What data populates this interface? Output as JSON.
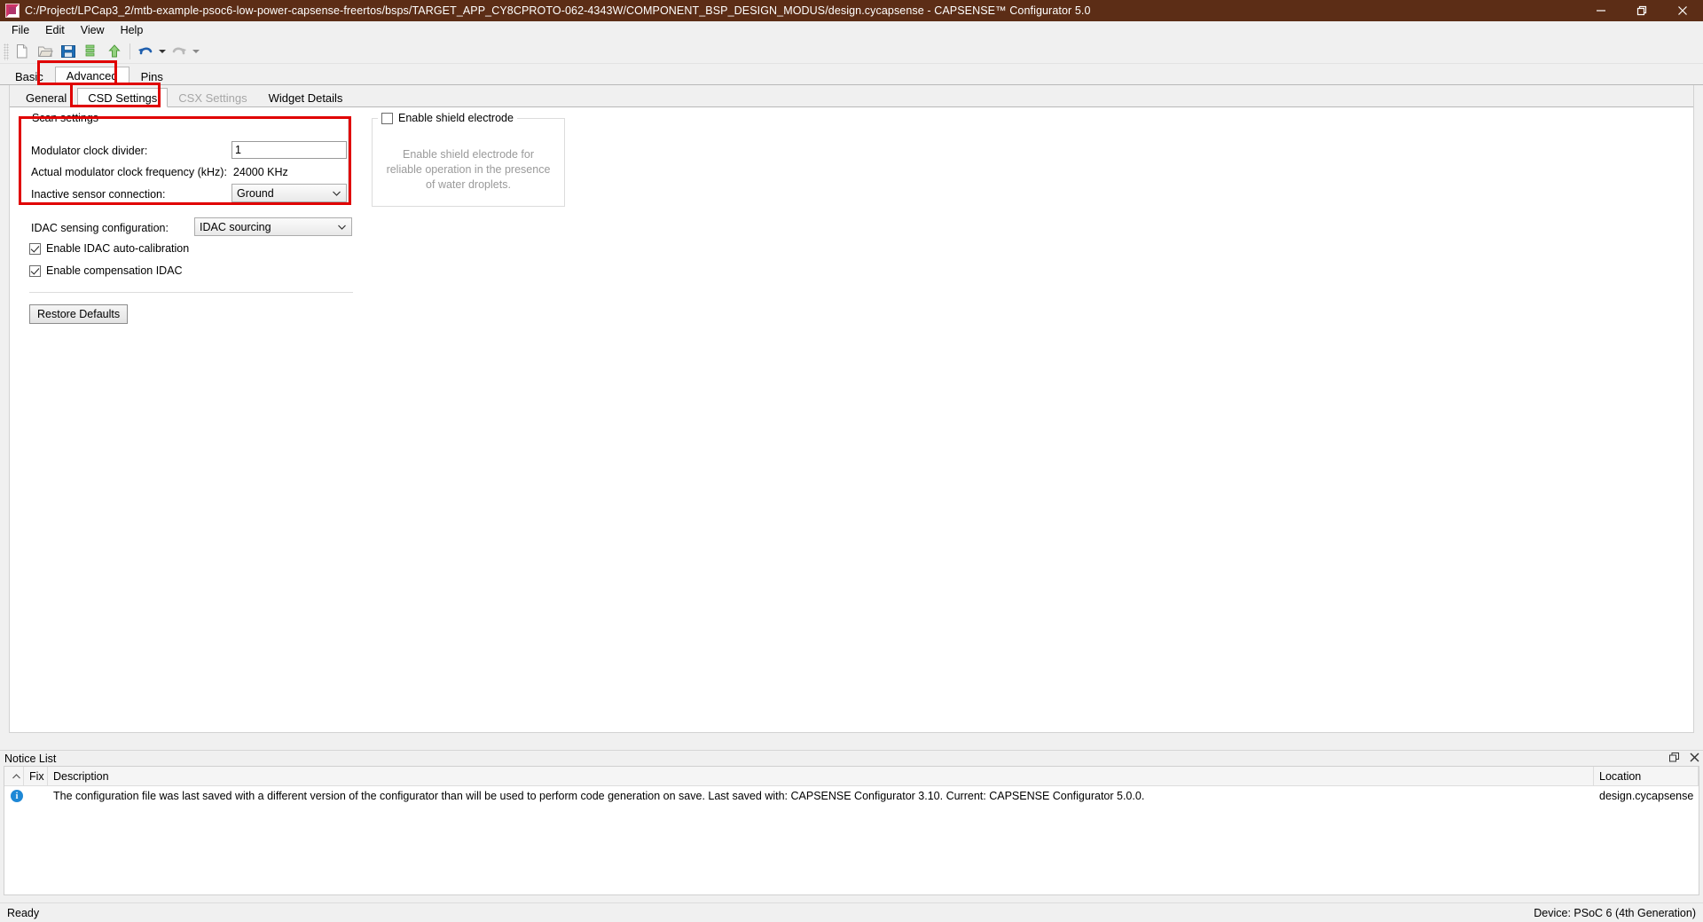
{
  "window": {
    "title": "C:/Project/LPCap3_2/mtb-example-psoc6-low-power-capsense-freertos/bsps/TARGET_APP_CY8CPROTO-062-4343W/COMPONENT_BSP_DESIGN_MODUS/design.cycapsense - CAPSENSE™ Configurator 5.0",
    "titlebar_color": "#5c2d16",
    "minimize": "minimize-icon",
    "maximize": "maximize-icon",
    "close": "close-icon"
  },
  "menu": {
    "items": [
      {
        "label": "File"
      },
      {
        "label": "Edit"
      },
      {
        "label": "View"
      },
      {
        "label": "Help"
      }
    ]
  },
  "toolbar": {
    "buttons": [
      {
        "name": "new-file-icon",
        "title": "New"
      },
      {
        "name": "open-folder-icon",
        "title": "Open"
      },
      {
        "name": "save-icon",
        "title": "Save"
      },
      {
        "name": "import-icon",
        "title": "Import"
      },
      {
        "name": "export-icon",
        "title": "Export"
      },
      {
        "name": "undo-icon",
        "title": "Undo"
      },
      {
        "name": "redo-icon",
        "title": "Redo"
      }
    ]
  },
  "main_tabs": {
    "items": [
      {
        "label": "Basic",
        "active": false
      },
      {
        "label": "Advanced",
        "active": true,
        "highlighted": true
      },
      {
        "label": "Pins",
        "active": false
      }
    ]
  },
  "sub_tabs": {
    "items": [
      {
        "label": "General",
        "active": false,
        "disabled": false
      },
      {
        "label": "CSD Settings",
        "active": true,
        "disabled": false,
        "highlighted": true
      },
      {
        "label": "CSX Settings",
        "active": false,
        "disabled": true
      },
      {
        "label": "Widget Details",
        "active": false,
        "disabled": false
      }
    ]
  },
  "csd_settings": {
    "scan_group": {
      "title": "Scan settings",
      "modulator_clock_divider": {
        "label": "Modulator clock divider:",
        "value": "1"
      },
      "actual_modulator_clock_frequency": {
        "label": "Actual modulator clock frequency (kHz):",
        "value": "24000 KHz"
      },
      "inactive_sensor_connection": {
        "label": "Inactive sensor connection:",
        "value": "Ground"
      }
    },
    "shield": {
      "checkbox_label": "Enable shield electrode",
      "checked": false,
      "description": "Enable shield electrode for reliable operation in the presence of water droplets."
    },
    "idac_sensing_configuration": {
      "label": "IDAC sensing configuration:",
      "value": "IDAC sourcing"
    },
    "enable_idac_auto_calibration": {
      "label": "Enable IDAC auto-calibration",
      "checked": true
    },
    "enable_compensation_idac": {
      "label": "Enable compensation IDAC",
      "checked": true
    },
    "restore_defaults_label": "Restore Defaults"
  },
  "notice_list": {
    "title": "Notice List",
    "float_icon": "restore-panel-icon",
    "close_icon": "close-panel-icon",
    "columns": [
      "Fix",
      "Description",
      "Location"
    ],
    "rows": [
      {
        "severity": "info",
        "fix": "",
        "description": "The configuration file was last saved with a different version of the configurator than will be used to perform code generation on save. Last saved with: CAPSENSE Configurator 3.10. Current: CAPSENSE Configurator 5.0.0.",
        "location": "design.cycapsense"
      }
    ]
  },
  "status_bar": {
    "left": "Ready",
    "right": "Device: PSoC 6 (4th Generation)"
  },
  "colors": {
    "highlight": "#e00000",
    "accent_title": "#5c2d16",
    "info": "#1e88d6"
  }
}
